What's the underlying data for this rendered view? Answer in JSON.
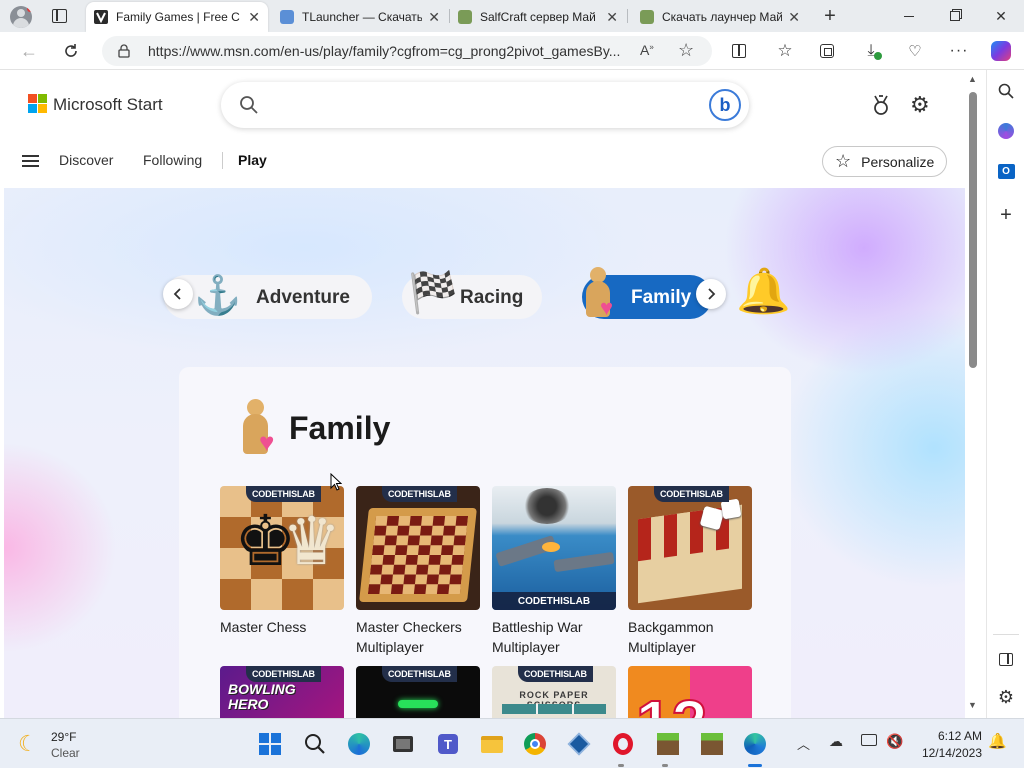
{
  "browser": {
    "tabs": [
      {
        "title": "Family Games | Free C",
        "active": true,
        "favicon_color": "#2b2b2b"
      },
      {
        "title": "TLauncher — Скачать",
        "active": false,
        "favicon_color": "#5b8fd6"
      },
      {
        "title": "SalfCraft сервер Май",
        "active": false,
        "favicon_color": "#7a9b57"
      },
      {
        "title": "Скачать лаунчер Май",
        "active": false,
        "favicon_color": "#7a9b57"
      }
    ],
    "new_tab_label": "+",
    "address_url": "https://www.msn.com/en-us/play/family?cgfrom=cg_prong2pivot_gamesBy..."
  },
  "header": {
    "brand": "Microsoft Start",
    "search_placeholder": "",
    "nav": {
      "discover": "Discover",
      "following": "Following",
      "play": "Play"
    },
    "personalize_label": "Personalize"
  },
  "categories": [
    {
      "label": "Adventure",
      "icon": "anchor-icon",
      "selected": false
    },
    {
      "label": "Racing",
      "icon": "checkered-flag-icon",
      "selected": false
    },
    {
      "label": "Family",
      "icon": "family-pawn-icon",
      "selected": true
    },
    {
      "label": "",
      "icon": "bell-icon",
      "selected": false
    }
  ],
  "section": {
    "title": "Family",
    "badge_text": "CODETHISLAB",
    "games": [
      {
        "title": "Master Chess",
        "art": "chess"
      },
      {
        "title": "Master Checkers Multiplayer",
        "art": "checkers"
      },
      {
        "title": "Battleship War Multiplayer",
        "art": "battleship"
      },
      {
        "title": "Backgammon Multiplayer",
        "art": "backgammon"
      },
      {
        "title": "",
        "art": "bowling",
        "art_text": "BOWLING HERO"
      },
      {
        "title": "",
        "art": "dark"
      },
      {
        "title": "",
        "art": "rps",
        "art_text": "ROCK PAPER SCISSORS"
      },
      {
        "title": "",
        "art": "twelve",
        "art_text": "12"
      }
    ]
  },
  "taskbar": {
    "weather": {
      "temp": "29°F",
      "condition": "Clear"
    },
    "clock": {
      "time": "6:12 AM",
      "date": "12/14/2023"
    },
    "pinned": [
      "windows-start-icon",
      "search-icon",
      "edge-beta-icon",
      "task-view-icon",
      "teams-icon",
      "file-explorer-icon",
      "chrome-icon",
      "virtualbox-icon",
      "opera-icon",
      "minecraft-icon",
      "minecraft-icon",
      "edge-icon"
    ]
  },
  "colors": {
    "accent": "#0f6cbd",
    "family_pill": "#1769c2",
    "tab_strip": "#e9ecef",
    "taskbar": "#e9eef6"
  }
}
